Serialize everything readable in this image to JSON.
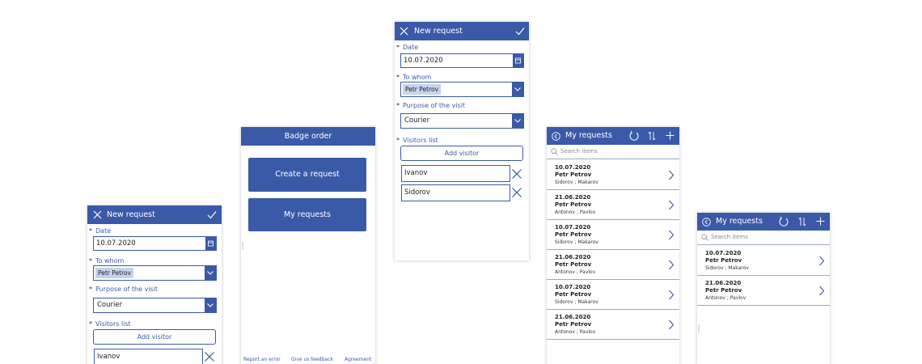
{
  "colors": {
    "accent": "#3a5aa8",
    "chip": "#c5d3eb",
    "divider": "#9aa9c7"
  },
  "new_request": {
    "title": "New request",
    "required_mark": "*",
    "date_label": "Date",
    "date_value": "10.07.2020",
    "to_whom_label": "To whom",
    "to_whom_value": "Petr Petrov",
    "purpose_label": "Purpose of the visit",
    "purpose_value": "Courier",
    "visitors_label": "Visitors list",
    "add_visitor": "Add visitor",
    "visitors": [
      "Ivanov",
      "Sidorov"
    ]
  },
  "menu": {
    "title": "Badge order",
    "create_request": "Create a request",
    "my_requests": "My requests",
    "footer": [
      "Report an error",
      "Give us feedback",
      "Agreement"
    ]
  },
  "my_requests": {
    "title": "My requests",
    "search_placeholder": "Search items",
    "items": [
      {
        "date": "10.07.2020",
        "name": "Petr Petrov",
        "visitors": "Sidorov ; Makarov"
      },
      {
        "date": "21.06.2020",
        "name": "Petr Petrov",
        "visitors": "Antonov ; Pavlov"
      },
      {
        "date": "10.07.2020",
        "name": "Petr Petrov",
        "visitors": "Sidorov ; Makarov"
      },
      {
        "date": "21.06.2020",
        "name": "Petr Petrov",
        "visitors": "Antonov ; Pavlov"
      },
      {
        "date": "10.07.2020",
        "name": "Petr Petrov",
        "visitors": "Sidorov ; Makarov"
      },
      {
        "date": "21.06.2020",
        "name": "Petr Petrov",
        "visitors": "Antonov ; Pavlov"
      }
    ]
  }
}
